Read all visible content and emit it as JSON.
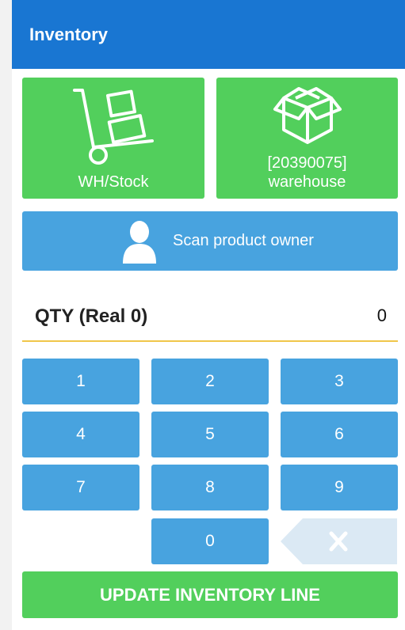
{
  "app_bar": {
    "title": "Inventory"
  },
  "tiles": {
    "location": {
      "label": "WH/Stock",
      "icon": "hand-truck-icon"
    },
    "warehouse": {
      "code": "[20390075]",
      "name": "warehouse",
      "icon": "open-box-icon"
    }
  },
  "owner_button": {
    "label": "Scan product owner",
    "icon": "person-icon"
  },
  "quantity": {
    "label": "QTY (Real 0)",
    "value": "0"
  },
  "keypad": {
    "keys": [
      "1",
      "2",
      "3",
      "4",
      "5",
      "6",
      "7",
      "8",
      "9",
      "0"
    ],
    "backspace_icon": "backspace-icon"
  },
  "update_button": {
    "label": "UPDATE INVENTORY LINE"
  },
  "colors": {
    "app_bar": "#1976d2",
    "green": "#52cf5c",
    "blue": "#48a3df",
    "backspace": "#dbe9f4",
    "qty_underline": "#f0c64a"
  }
}
